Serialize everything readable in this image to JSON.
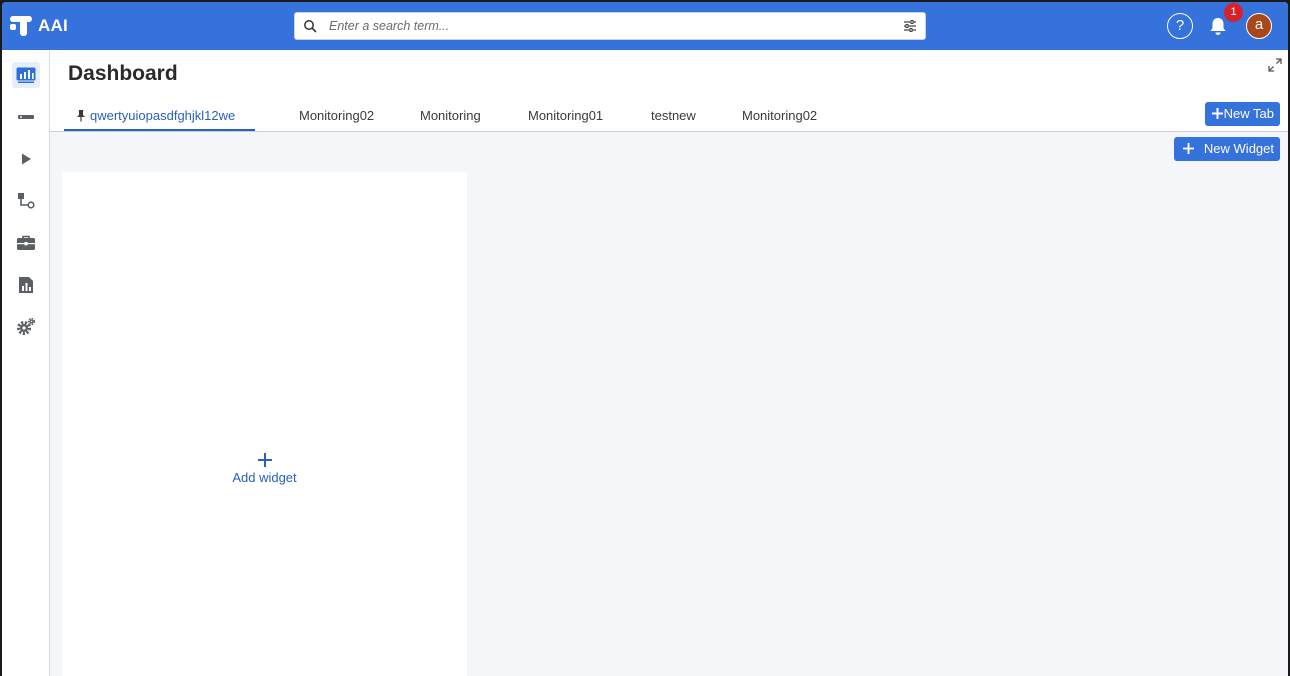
{
  "app": {
    "logo_text": "AAI",
    "accent_color": "#3572dc"
  },
  "search": {
    "placeholder": "Enter a search term...",
    "value": ""
  },
  "header": {
    "help_label": "?",
    "notification_count": "1",
    "avatar_initial": "a"
  },
  "sidebar": {
    "items": [
      {
        "icon": "dashboard-chart-icon",
        "active": true
      },
      {
        "icon": "minus-bar-icon",
        "active": false
      },
      {
        "icon": "play-icon",
        "active": false
      },
      {
        "icon": "workflow-icon",
        "active": false
      },
      {
        "icon": "toolbox-icon",
        "active": false
      },
      {
        "icon": "report-icon",
        "active": false
      },
      {
        "icon": "settings-gears-icon",
        "active": false
      }
    ]
  },
  "page": {
    "title": "Dashboard"
  },
  "tabs": [
    {
      "label": "qwertyuiopasdfghjkl12we",
      "active": true,
      "pinned": true
    },
    {
      "label": "Monitoring02",
      "active": false
    },
    {
      "label": "Monitoring",
      "active": false
    },
    {
      "label": "Monitoring01",
      "active": false
    },
    {
      "label": "testnew",
      "active": false
    },
    {
      "label": "Monitoring02",
      "active": false
    }
  ],
  "actions": {
    "new_tab_label": "New Tab",
    "new_widget_label": "New Widget",
    "add_widget_label": "Add widget"
  }
}
